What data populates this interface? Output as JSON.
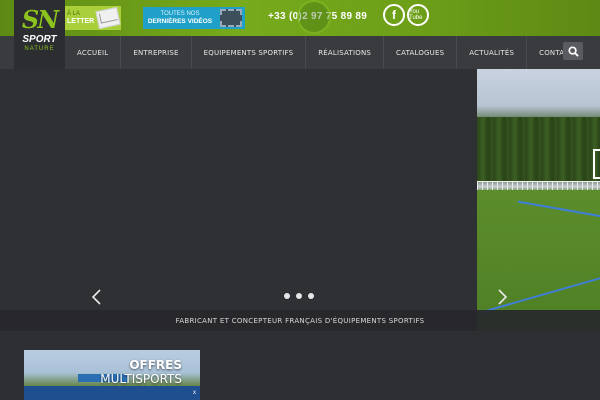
{
  "brand": {
    "logo_mark": "SN",
    "logo_word": "SPORT",
    "logo_sub": "NATURE"
  },
  "topbar": {
    "newsletter_line1": "À LA",
    "newsletter_line2": "LETTER",
    "videos_line1": "TOUTES NOS",
    "videos_line2": "DERNIÈRES VIDÉOS",
    "phone": "+33 (0)2 97 75 89 89",
    "facebook_label": "f",
    "youtube_label": "You Tube"
  },
  "nav": {
    "items": [
      "Accueil",
      "Entreprise",
      "Equipements sportifs",
      "Réalisations",
      "Catalogues",
      "Actualités",
      "Contact"
    ]
  },
  "slider": {
    "caption": "Fabricant et concepteur français d'équipements sportifs",
    "dots": 3
  },
  "offers": {
    "title_line1": "OFFRES",
    "title_line2": "MULTISPORTS",
    "badge": "x"
  },
  "colors": {
    "brand_green": "#77aa1c",
    "nav_bg": "#3a3b3f",
    "page_bg": "#2e2f33"
  }
}
